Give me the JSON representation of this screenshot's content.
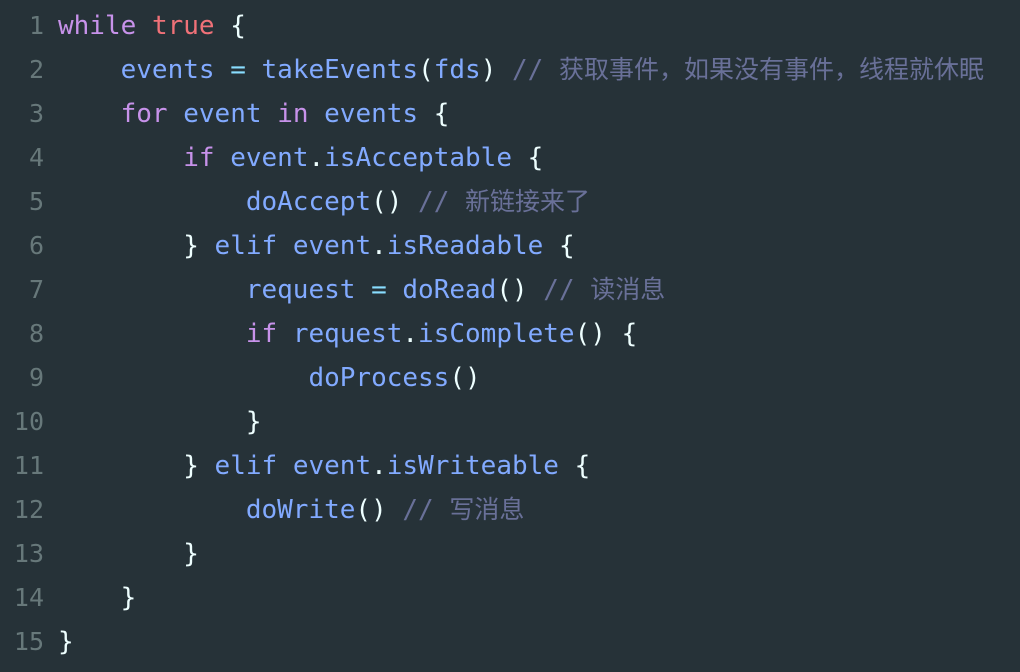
{
  "editor": {
    "background_color": "#263238",
    "gutter_color": "#67787a",
    "language": "pseudocode",
    "total_lines": 15,
    "colors": {
      "keyword": "#c792ea",
      "boolean": "#f07178",
      "identifier": "#82aaff",
      "punctuation": "#eeffff",
      "operator": "#89ddff",
      "comment": "#697098"
    }
  },
  "lines": [
    {
      "number": "1",
      "indent": "",
      "tokens": [
        {
          "text": "while",
          "type": "keyword"
        },
        {
          "text": " ",
          "type": "punct"
        },
        {
          "text": "true",
          "type": "bool"
        },
        {
          "text": " ",
          "type": "punct"
        },
        {
          "text": "{",
          "type": "punct"
        }
      ]
    },
    {
      "number": "2",
      "indent": "    ",
      "tokens": [
        {
          "text": "events",
          "type": "ident"
        },
        {
          "text": " ",
          "type": "punct"
        },
        {
          "text": "=",
          "type": "operator"
        },
        {
          "text": " ",
          "type": "punct"
        },
        {
          "text": "takeEvents",
          "type": "ident"
        },
        {
          "text": "(",
          "type": "punct"
        },
        {
          "text": "fds",
          "type": "ident"
        },
        {
          "text": ")",
          "type": "punct"
        },
        {
          "text": " ",
          "type": "punct"
        },
        {
          "text": "// ",
          "type": "comment"
        },
        {
          "text": "获取事件，如果没有事件，线程就休眠",
          "type": "comment-cjk"
        }
      ]
    },
    {
      "number": "3",
      "indent": "    ",
      "tokens": [
        {
          "text": "for",
          "type": "keyword"
        },
        {
          "text": " ",
          "type": "punct"
        },
        {
          "text": "event",
          "type": "ident"
        },
        {
          "text": " ",
          "type": "punct"
        },
        {
          "text": "in",
          "type": "keyword"
        },
        {
          "text": " ",
          "type": "punct"
        },
        {
          "text": "events",
          "type": "ident"
        },
        {
          "text": " ",
          "type": "punct"
        },
        {
          "text": "{",
          "type": "punct"
        }
      ]
    },
    {
      "number": "4",
      "indent": "        ",
      "tokens": [
        {
          "text": "if",
          "type": "keyword"
        },
        {
          "text": " ",
          "type": "punct"
        },
        {
          "text": "event",
          "type": "ident"
        },
        {
          "text": ".",
          "type": "punct"
        },
        {
          "text": "isAcceptable",
          "type": "ident"
        },
        {
          "text": " ",
          "type": "punct"
        },
        {
          "text": "{",
          "type": "punct"
        }
      ]
    },
    {
      "number": "5",
      "indent": "            ",
      "tokens": [
        {
          "text": "doAccept",
          "type": "ident"
        },
        {
          "text": "()",
          "type": "punct"
        },
        {
          "text": " ",
          "type": "punct"
        },
        {
          "text": "// ",
          "type": "comment"
        },
        {
          "text": "新链接来了",
          "type": "comment-cjk"
        }
      ]
    },
    {
      "number": "6",
      "indent": "        ",
      "tokens": [
        {
          "text": "}",
          "type": "punct"
        },
        {
          "text": " ",
          "type": "punct"
        },
        {
          "text": "elif",
          "type": "ident"
        },
        {
          "text": " ",
          "type": "punct"
        },
        {
          "text": "event",
          "type": "ident"
        },
        {
          "text": ".",
          "type": "punct"
        },
        {
          "text": "isReadable",
          "type": "ident"
        },
        {
          "text": " ",
          "type": "punct"
        },
        {
          "text": "{",
          "type": "punct"
        }
      ]
    },
    {
      "number": "7",
      "indent": "            ",
      "tokens": [
        {
          "text": "request",
          "type": "ident"
        },
        {
          "text": " ",
          "type": "punct"
        },
        {
          "text": "=",
          "type": "operator"
        },
        {
          "text": " ",
          "type": "punct"
        },
        {
          "text": "doRead",
          "type": "ident"
        },
        {
          "text": "()",
          "type": "punct"
        },
        {
          "text": " ",
          "type": "punct"
        },
        {
          "text": "// ",
          "type": "comment"
        },
        {
          "text": "读消息",
          "type": "comment-cjk"
        }
      ]
    },
    {
      "number": "8",
      "indent": "            ",
      "tokens": [
        {
          "text": "if",
          "type": "keyword"
        },
        {
          "text": " ",
          "type": "punct"
        },
        {
          "text": "request",
          "type": "ident"
        },
        {
          "text": ".",
          "type": "punct"
        },
        {
          "text": "isComplete",
          "type": "ident"
        },
        {
          "text": "()",
          "type": "punct"
        },
        {
          "text": " ",
          "type": "punct"
        },
        {
          "text": "{",
          "type": "punct"
        }
      ]
    },
    {
      "number": "9",
      "indent": "                ",
      "tokens": [
        {
          "text": "doProcess",
          "type": "ident"
        },
        {
          "text": "()",
          "type": "punct"
        }
      ]
    },
    {
      "number": "10",
      "indent": "            ",
      "tokens": [
        {
          "text": "}",
          "type": "punct"
        }
      ]
    },
    {
      "number": "11",
      "indent": "        ",
      "tokens": [
        {
          "text": "}",
          "type": "punct"
        },
        {
          "text": " ",
          "type": "punct"
        },
        {
          "text": "elif",
          "type": "ident"
        },
        {
          "text": " ",
          "type": "punct"
        },
        {
          "text": "event",
          "type": "ident"
        },
        {
          "text": ".",
          "type": "punct"
        },
        {
          "text": "isWriteable",
          "type": "ident"
        },
        {
          "text": " ",
          "type": "punct"
        },
        {
          "text": "{",
          "type": "punct"
        }
      ]
    },
    {
      "number": "12",
      "indent": "            ",
      "tokens": [
        {
          "text": "doWrite",
          "type": "ident"
        },
        {
          "text": "()",
          "type": "punct"
        },
        {
          "text": " ",
          "type": "punct"
        },
        {
          "text": "// ",
          "type": "comment"
        },
        {
          "text": "写消息",
          "type": "comment-cjk"
        }
      ]
    },
    {
      "number": "13",
      "indent": "        ",
      "tokens": [
        {
          "text": "}",
          "type": "punct"
        }
      ]
    },
    {
      "number": "14",
      "indent": "    ",
      "tokens": [
        {
          "text": "}",
          "type": "punct"
        }
      ]
    },
    {
      "number": "15",
      "indent": "",
      "tokens": [
        {
          "text": "}",
          "type": "punct"
        }
      ]
    }
  ]
}
